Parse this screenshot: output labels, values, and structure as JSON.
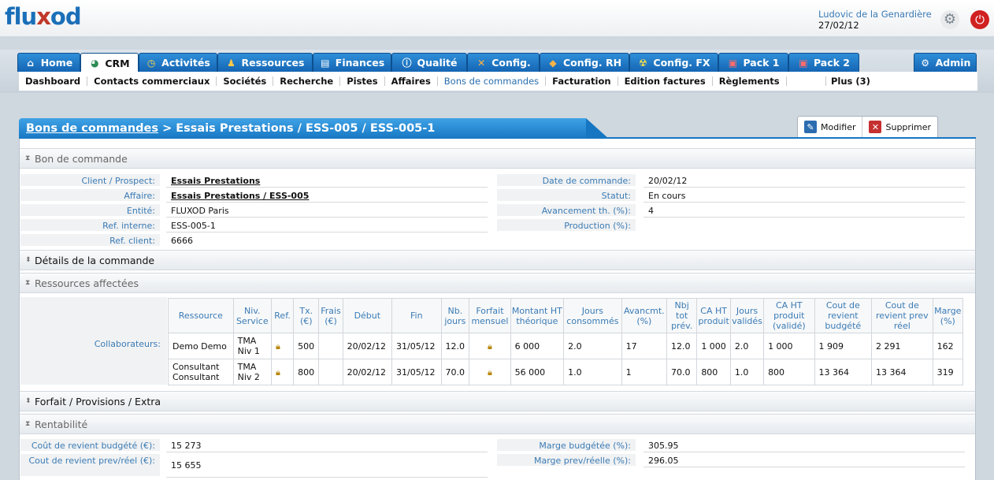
{
  "app": {
    "logo_part1": "flu",
    "logo_x": "x",
    "logo_part2": "od",
    "user_name": "Ludovic de la Genardière",
    "date": "27/02/12",
    "settings_icon": "gear-icon",
    "logout_icon": "power-icon"
  },
  "tabs": [
    {
      "label": "Home",
      "icon": "home-icon"
    },
    {
      "label": "CRM",
      "icon": "pie-icon"
    },
    {
      "label": "Activités",
      "icon": "clock-icon"
    },
    {
      "label": "Ressources",
      "icon": "people-icon"
    },
    {
      "label": "Finances",
      "icon": "chart-icon"
    },
    {
      "label": "Qualité",
      "icon": "info-icon"
    },
    {
      "label": "Config.",
      "icon": "tools-icon"
    },
    {
      "label": "Config. RH",
      "icon": "diamond-icon"
    },
    {
      "label": "Config. FX",
      "icon": "radiation-icon"
    },
    {
      "label": "Pack 1",
      "icon": "gift-icon"
    },
    {
      "label": "Pack 2",
      "icon": "gift-icon"
    },
    {
      "label": "Admin",
      "icon": "gear-icon"
    }
  ],
  "subnav": [
    "Dashboard",
    "Contacts commerciaux",
    "Sociétés",
    "Recherche",
    "Pistes",
    "Affaires",
    "Bons de commandes",
    "Facturation",
    "Edition factures",
    "Règlements"
  ],
  "subnav_plus": "Plus (3)",
  "panel": {
    "title_link": "Bons de commandes",
    "title_rest": " > Essais Prestations / ESS-005 / ESS-005-1",
    "btn_modify": "Modifier",
    "btn_delete": "Supprimer"
  },
  "sections": {
    "bdc": "Bon de commande",
    "details": "Détails de la commande",
    "ressources": "Ressources affectées",
    "forfait": "Forfait / Provisions / Extra",
    "rentabilite": "Rentabilité"
  },
  "bdc": {
    "left": [
      {
        "label": "Client / Prospect:",
        "value": "Essais Prestations"
      },
      {
        "label": "Affaire:",
        "value": "Essais Prestations / ESS-005"
      },
      {
        "label": "Entité:",
        "value": "FLUXOD Paris"
      },
      {
        "label": "Ref. interne:",
        "value": "ESS-005-1"
      },
      {
        "label": "Ref. client:",
        "value": "6666"
      }
    ],
    "right": [
      {
        "label": "Date de commande:",
        "value": "20/02/12"
      },
      {
        "label": "Statut:",
        "value": "En cours"
      },
      {
        "label": "Avancement th. (%):",
        "value": "4"
      },
      {
        "label": "Production (%):",
        "value": ""
      }
    ]
  },
  "ressources": {
    "label": "Collaborateurs:",
    "headers": [
      "Ressource",
      "Niv. Service",
      "Ref.",
      "Tx. (€)",
      "Frais (€)",
      "Début",
      "Fin",
      "Nb. jours",
      "Forfait mensuel",
      "Montant HT théorique",
      "Jours consommés",
      "Avancmt. (%)",
      "Nbj tot prév.",
      "CA HT produit",
      "Jours validés",
      "CA HT produit (validé)",
      "Cout de revient budgété",
      "Cout de revient prev réel",
      "Marge (%)"
    ],
    "rows": [
      [
        "Demo Demo",
        "TMA Niv 1",
        "",
        "500",
        "",
        "20/02/12",
        "31/05/12",
        "12.0",
        "",
        "6 000",
        "2.0",
        "17",
        "12.0",
        "1 000",
        "2.0",
        "1 000",
        "1 909",
        "2 291",
        "162"
      ],
      [
        "Consultant Consultant",
        "TMA Niv 2",
        "",
        "800",
        "",
        "20/02/12",
        "31/05/12",
        "70.0",
        "",
        "56 000",
        "1.0",
        "1",
        "70.0",
        "800",
        "1.0",
        "800",
        "13 364",
        "13 364",
        "319"
      ]
    ]
  },
  "rentabilite": {
    "left": [
      {
        "label": "Coût de revient budgété (€):",
        "value": "15 273"
      },
      {
        "label": "Cout de revient prev/réel (€):",
        "value": "15 655"
      }
    ],
    "right": [
      {
        "label": "Marge budgétée (%):",
        "value": "305.95"
      },
      {
        "label": "Marge prev/réelle (%):",
        "value": "296.05"
      }
    ]
  },
  "colors": {
    "accent": "#1676c2",
    "link": "#3a7bb5",
    "logo_x": "#c0392b"
  }
}
